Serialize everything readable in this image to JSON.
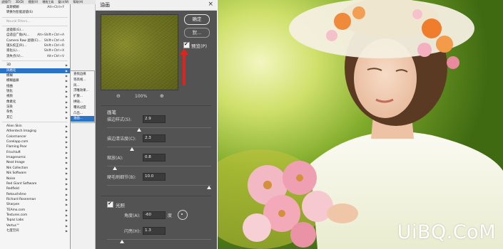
{
  "menubar": {
    "items": [
      "滤镜(T)",
      "3D(D)",
      "视图(V)",
      "增效工具",
      "窗口(W)",
      "帮助(H)"
    ]
  },
  "filter_menu": {
    "items": [
      {
        "label": "高斯模糊",
        "shortcut": "Alt+Ctrl+F",
        "disabled": false,
        "submenu": false,
        "highlight": false
      },
      {
        "label": "转换为智能滤镜(S)",
        "shortcut": "",
        "disabled": false,
        "submenu": false,
        "highlight": false
      },
      {
        "label": "Neural Filters...",
        "shortcut": "",
        "disabled": true,
        "submenu": false,
        "highlight": false
      },
      {
        "label": "滤镜库(G)...",
        "shortcut": "",
        "disabled": false,
        "submenu": false,
        "highlight": false
      },
      {
        "label": "自适应广角(A)...",
        "shortcut": "Alt+Shift+Ctrl+A",
        "disabled": false,
        "submenu": false,
        "highlight": false
      },
      {
        "label": "Camera Raw 滤镜(C)...",
        "shortcut": "Shift+Ctrl+A",
        "disabled": false,
        "submenu": false,
        "highlight": false
      },
      {
        "label": "镜头校正(R)...",
        "shortcut": "Shift+Ctrl+R",
        "disabled": false,
        "submenu": false,
        "highlight": false
      },
      {
        "label": "液化(L)...",
        "shortcut": "Shift+Ctrl+X",
        "disabled": false,
        "submenu": false,
        "highlight": false
      },
      {
        "label": "消失点(V)...",
        "shortcut": "Alt+Ctrl+V",
        "disabled": false,
        "submenu": false,
        "highlight": false
      },
      {
        "label": "3D",
        "shortcut": "",
        "disabled": false,
        "submenu": true,
        "highlight": false
      },
      {
        "label": "风格化",
        "shortcut": "",
        "disabled": false,
        "submenu": true,
        "highlight": true
      },
      {
        "label": "模糊",
        "shortcut": "",
        "disabled": false,
        "submenu": true,
        "highlight": false
      },
      {
        "label": "模糊画廊",
        "shortcut": "",
        "disabled": false,
        "submenu": true,
        "highlight": false
      },
      {
        "label": "扭曲",
        "shortcut": "",
        "disabled": false,
        "submenu": true,
        "highlight": false
      },
      {
        "label": "锐化",
        "shortcut": "",
        "disabled": false,
        "submenu": true,
        "highlight": false
      },
      {
        "label": "视频",
        "shortcut": "",
        "disabled": false,
        "submenu": true,
        "highlight": false
      },
      {
        "label": "像素化",
        "shortcut": "",
        "disabled": false,
        "submenu": true,
        "highlight": false
      },
      {
        "label": "渲染",
        "shortcut": "",
        "disabled": false,
        "submenu": true,
        "highlight": false
      },
      {
        "label": "杂色",
        "shortcut": "",
        "disabled": false,
        "submenu": true,
        "highlight": false
      },
      {
        "label": "其它",
        "shortcut": "",
        "disabled": false,
        "submenu": true,
        "highlight": false
      },
      {
        "label": "Alien Skin",
        "shortcut": "",
        "disabled": false,
        "submenu": true,
        "highlight": false
      },
      {
        "label": "Athentech Imaging",
        "shortcut": "",
        "disabled": false,
        "submenu": true,
        "highlight": false
      },
      {
        "label": "Colormancer",
        "shortcut": "",
        "disabled": false,
        "submenu": true,
        "highlight": false
      },
      {
        "label": "Corelapp.com",
        "shortcut": "",
        "disabled": false,
        "submenu": true,
        "highlight": false
      },
      {
        "label": "Flaming Pear",
        "shortcut": "",
        "disabled": false,
        "submenu": true,
        "highlight": false
      },
      {
        "label": "Frischluft",
        "shortcut": "",
        "disabled": false,
        "submenu": true,
        "highlight": false
      },
      {
        "label": "Imagenomic",
        "shortcut": "",
        "disabled": false,
        "submenu": true,
        "highlight": false
      },
      {
        "label": "Neat Image",
        "shortcut": "",
        "disabled": false,
        "submenu": true,
        "highlight": false
      },
      {
        "label": "Nik Collection",
        "shortcut": "",
        "disabled": false,
        "submenu": true,
        "highlight": false
      },
      {
        "label": "Nik Software",
        "shortcut": "",
        "disabled": false,
        "submenu": true,
        "highlight": false
      },
      {
        "label": "Noise",
        "shortcut": "",
        "disabled": false,
        "submenu": true,
        "highlight": false
      },
      {
        "label": "Red Giant Software",
        "shortcut": "",
        "disabled": false,
        "submenu": true,
        "highlight": false
      },
      {
        "label": "Redfield",
        "shortcut": "",
        "disabled": false,
        "submenu": true,
        "highlight": false
      },
      {
        "label": "Retouch4me",
        "shortcut": "",
        "disabled": false,
        "submenu": true,
        "highlight": false
      },
      {
        "label": "Richard Rosenman",
        "shortcut": "",
        "disabled": false,
        "submenu": true,
        "highlight": false
      },
      {
        "label": "Sharpen",
        "shortcut": "",
        "disabled": false,
        "submenu": true,
        "highlight": false
      },
      {
        "label": "TEAmo.com",
        "shortcut": "",
        "disabled": false,
        "submenu": true,
        "highlight": false
      },
      {
        "label": "Textures.com",
        "shortcut": "",
        "disabled": false,
        "submenu": true,
        "highlight": false
      },
      {
        "label": "Topaz Labs",
        "shortcut": "",
        "disabled": false,
        "submenu": true,
        "highlight": false
      },
      {
        "label": "Vertus™",
        "shortcut": "",
        "disabled": false,
        "submenu": true,
        "highlight": false
      },
      {
        "label": "七度空间",
        "shortcut": "",
        "disabled": false,
        "submenu": true,
        "highlight": false
      }
    ]
  },
  "submenu": {
    "items": [
      {
        "label": "查找边缘",
        "highlight": false
      },
      {
        "label": "等高线...",
        "highlight": false
      },
      {
        "label": "风...",
        "highlight": false
      },
      {
        "label": "浮雕效果...",
        "highlight": false
      },
      {
        "label": "扩散...",
        "highlight": false
      },
      {
        "label": "拼贴...",
        "highlight": false
      },
      {
        "label": "曝光过度",
        "highlight": false
      },
      {
        "label": "凸出...",
        "highlight": false
      },
      {
        "label": "油画...",
        "highlight": true
      }
    ]
  },
  "dialog": {
    "title": "油画",
    "ok_label": "确定",
    "default_label": "默...",
    "preview_label": "预览(P)",
    "preview_checked": true,
    "zoom": "100%",
    "brush_section": "画笔",
    "params": [
      {
        "label": "描边样式(S):",
        "value": "2.9",
        "slider": 0.3
      },
      {
        "label": "描边清洁度(C):",
        "value": "2.3",
        "slider": 0.23
      },
      {
        "label": "缩放(A):",
        "value": "0.8",
        "slider": 0.06
      },
      {
        "label": "硬毛刷细节(B):",
        "value": "10.0",
        "slider": 1.0
      }
    ],
    "lighting_section": "光照",
    "lighting_checked": true,
    "angle": {
      "label": "角度(A):",
      "value": "-60",
      "unit": "度"
    },
    "shine": {
      "label": "闪亮(H):",
      "value": "1.3",
      "slider": 0.13
    }
  },
  "photo": {
    "watermark": "UiBQ.CoM"
  },
  "colors": {
    "accent": "#2a73c9",
    "arrow": "#e0241b",
    "dialog_bg": "#535353"
  }
}
